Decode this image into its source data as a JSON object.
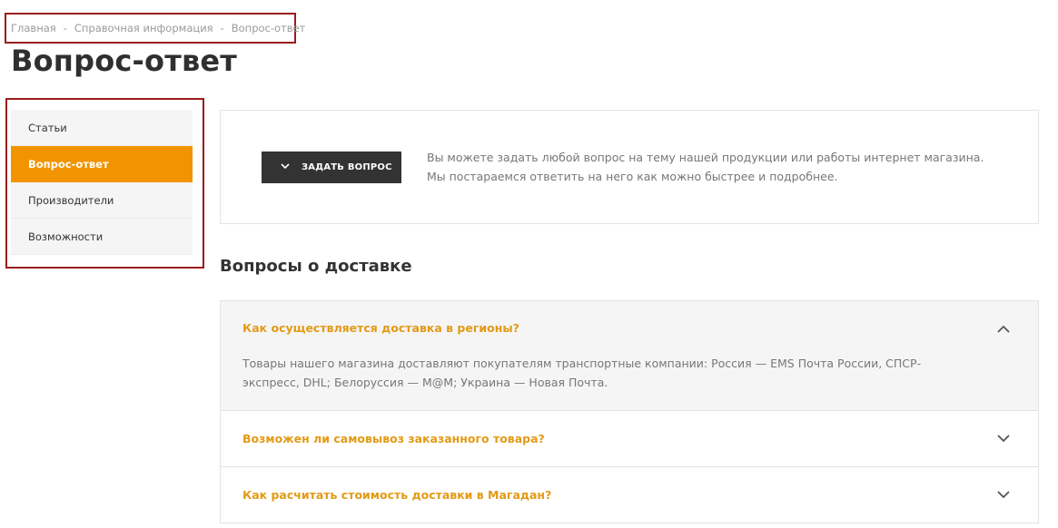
{
  "breadcrumb": {
    "items": [
      "Главная",
      "Справочная информация",
      "Вопрос-ответ"
    ],
    "separator": "-"
  },
  "page": {
    "title": "Вопрос-ответ"
  },
  "sidebar": {
    "items": [
      {
        "label": "Статьи",
        "active": false
      },
      {
        "label": "Вопрос-ответ",
        "active": true
      },
      {
        "label": "Производители",
        "active": false
      },
      {
        "label": "Возможности",
        "active": false
      }
    ]
  },
  "ask": {
    "button_label": "ЗАДАТЬ ВОПРОС",
    "button_icon": "chevron-down-icon",
    "text_line1": "Вы можете задать любой вопрос на тему нашей продукции или работы интернет магазина.",
    "text_line2": "Мы постараемся ответить на него как можно быстрее и подробнее."
  },
  "section": {
    "title": "Вопросы о доставке"
  },
  "faq": {
    "items": [
      {
        "question": "Как осуществляется доставка в регионы?",
        "answer": "Товары нашего магазина доставляют покупателям транспортные компании: Россия — EMS Почта России, СПСР-экспресс, DHL; Белоруссия — M@M; Украина — Новая Почта.",
        "open": true
      },
      {
        "question": "Возможен ли самовывоз заказанного товара?",
        "open": false
      },
      {
        "question": "Как расчитать стоимость доставки в Магадан?",
        "open": false
      }
    ]
  },
  "colors": {
    "accent": "#f29400",
    "question_text": "#e39a16",
    "button_bg": "#333333",
    "highlight_border": "#9b1c1c"
  }
}
